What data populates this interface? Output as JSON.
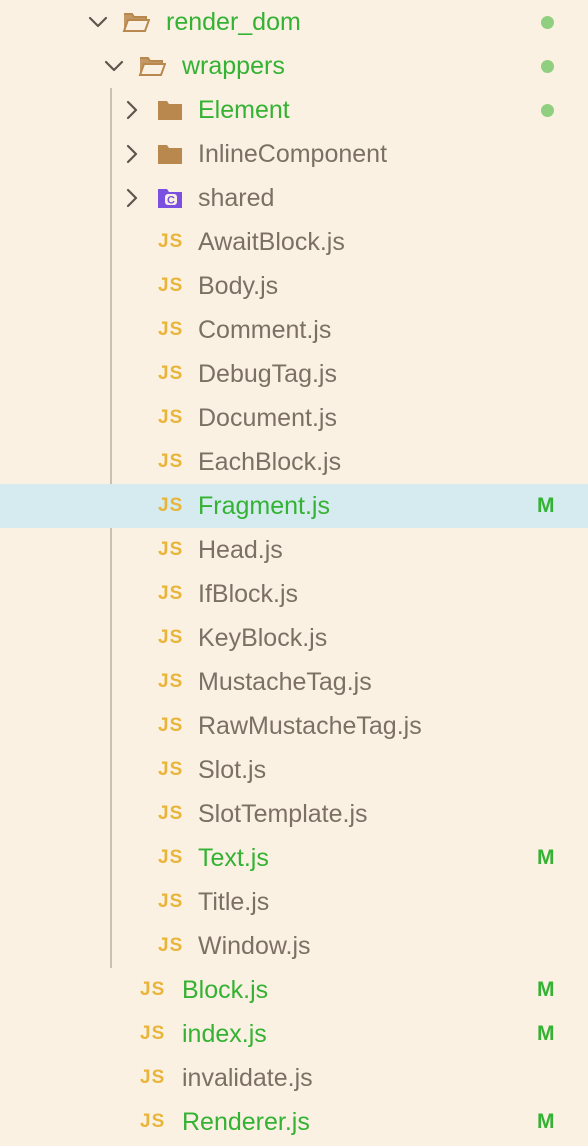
{
  "colors": {
    "background": "#fbf1e3",
    "selected_row": "#d5ebef",
    "modified_green": "#34b233",
    "default_text": "#7c7065",
    "js_icon": "#e9b43a",
    "folder_icon": "#b8884e",
    "shared_icon": "#7b4fe0",
    "dot": "#8fcf7f"
  },
  "tree": {
    "items": [
      {
        "label": "render_dom",
        "type": "folder-open",
        "expanded": true,
        "depth": 0,
        "modified": true,
        "status": "dot"
      },
      {
        "label": "wrappers",
        "type": "folder-open",
        "expanded": true,
        "depth": 1,
        "modified": true,
        "status": "dot"
      },
      {
        "label": "Element",
        "type": "folder",
        "expanded": false,
        "depth": 2,
        "modified": true,
        "status": "dot"
      },
      {
        "label": "InlineComponent",
        "type": "folder",
        "expanded": false,
        "depth": 2,
        "modified": false,
        "status": ""
      },
      {
        "label": "shared",
        "type": "folder-shared",
        "expanded": false,
        "depth": 2,
        "modified": false,
        "status": ""
      },
      {
        "label": "AwaitBlock.js",
        "type": "js",
        "depth": 2,
        "modified": false,
        "status": ""
      },
      {
        "label": "Body.js",
        "type": "js",
        "depth": 2,
        "modified": false,
        "status": ""
      },
      {
        "label": "Comment.js",
        "type": "js",
        "depth": 2,
        "modified": false,
        "status": ""
      },
      {
        "label": "DebugTag.js",
        "type": "js",
        "depth": 2,
        "modified": false,
        "status": ""
      },
      {
        "label": "Document.js",
        "type": "js",
        "depth": 2,
        "modified": false,
        "status": ""
      },
      {
        "label": "EachBlock.js",
        "type": "js",
        "depth": 2,
        "modified": false,
        "status": ""
      },
      {
        "label": "Fragment.js",
        "type": "js",
        "depth": 2,
        "modified": true,
        "status": "M",
        "selected": true
      },
      {
        "label": "Head.js",
        "type": "js",
        "depth": 2,
        "modified": false,
        "status": ""
      },
      {
        "label": "IfBlock.js",
        "type": "js",
        "depth": 2,
        "modified": false,
        "status": ""
      },
      {
        "label": "KeyBlock.js",
        "type": "js",
        "depth": 2,
        "modified": false,
        "status": ""
      },
      {
        "label": "MustacheTag.js",
        "type": "js",
        "depth": 2,
        "modified": false,
        "status": ""
      },
      {
        "label": "RawMustacheTag.js",
        "type": "js",
        "depth": 2,
        "modified": false,
        "status": ""
      },
      {
        "label": "Slot.js",
        "type": "js",
        "depth": 2,
        "modified": false,
        "status": ""
      },
      {
        "label": "SlotTemplate.js",
        "type": "js",
        "depth": 2,
        "modified": false,
        "status": ""
      },
      {
        "label": "Text.js",
        "type": "js",
        "depth": 2,
        "modified": true,
        "status": "M"
      },
      {
        "label": "Title.js",
        "type": "js",
        "depth": 2,
        "modified": false,
        "status": ""
      },
      {
        "label": "Window.js",
        "type": "js",
        "depth": 2,
        "modified": false,
        "status": ""
      },
      {
        "label": "Block.js",
        "type": "js",
        "depth": 1,
        "modified": true,
        "status": "M"
      },
      {
        "label": "index.js",
        "type": "js",
        "depth": 1,
        "modified": true,
        "status": "M"
      },
      {
        "label": "invalidate.js",
        "type": "js",
        "depth": 1,
        "modified": false,
        "status": ""
      },
      {
        "label": "Renderer.js",
        "type": "js",
        "depth": 1,
        "modified": true,
        "status": "M"
      }
    ],
    "js_icon_text": "JS"
  }
}
